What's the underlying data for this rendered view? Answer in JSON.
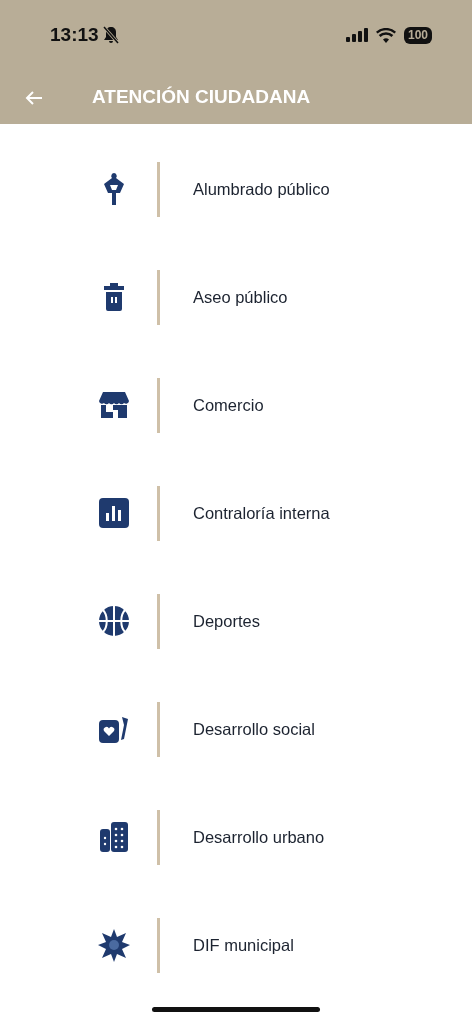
{
  "status_bar": {
    "time": "13:13",
    "battery": "100"
  },
  "header": {
    "title": "ATENCIÓN CIUDADANA"
  },
  "items": [
    {
      "kind": "lamp",
      "label": "Alumbrado público"
    },
    {
      "kind": "trash",
      "label": "Aseo público"
    },
    {
      "kind": "store",
      "label": "Comercio"
    },
    {
      "kind": "chart",
      "label": "Contraloría interna"
    },
    {
      "kind": "ball",
      "label": "Deportes"
    },
    {
      "kind": "cards",
      "label": "Desarrollo social"
    },
    {
      "kind": "building",
      "label": "Desarrollo urbano"
    },
    {
      "kind": "star",
      "label": "DIF municipal"
    }
  ]
}
